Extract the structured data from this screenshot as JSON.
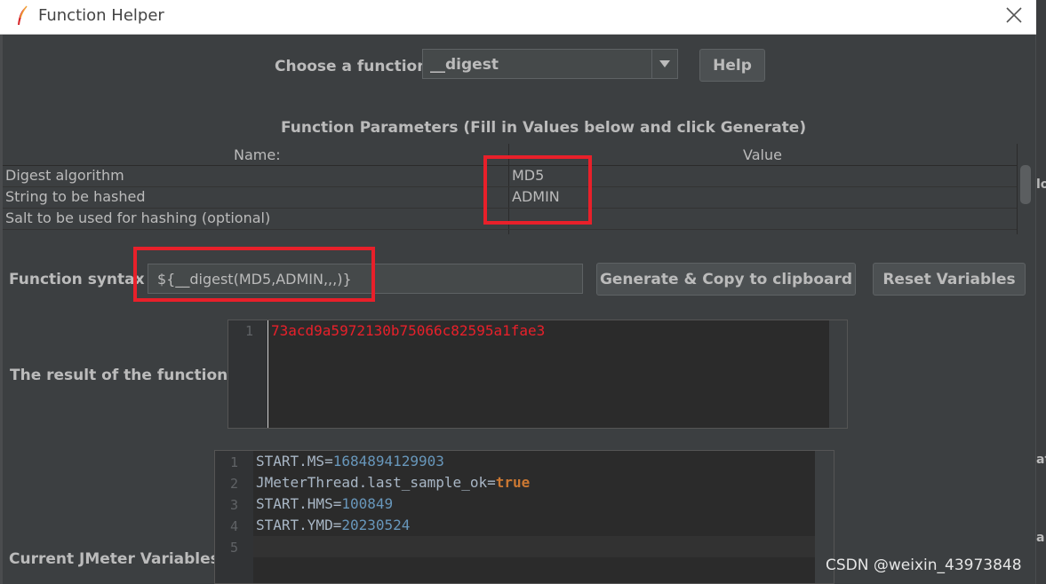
{
  "window": {
    "title": "Function Helper"
  },
  "header": {
    "choose_label": "Choose a function",
    "selected_function": "__digest",
    "help_label": "Help"
  },
  "parameters": {
    "section_title": "Function Parameters (Fill in Values below and click Generate)",
    "columns": [
      "Name:",
      "Value"
    ],
    "rows": [
      {
        "name": "Digest algorithm",
        "value": "MD5"
      },
      {
        "name": "String to be hashed",
        "value": "ADMIN"
      },
      {
        "name": "Salt to be used for hashing (optional)",
        "value": ""
      }
    ]
  },
  "syntax": {
    "label": "Function syntax",
    "value": "${__digest(MD5,ADMIN,,,)}",
    "generate_label": "Generate & Copy to clipboard",
    "reset_label": "Reset Variables"
  },
  "result": {
    "label": "The result of the function is",
    "lines": [
      {
        "no": "1",
        "text": "73acd9a5972130b75066c82595a1fae3"
      }
    ],
    "text_color": "#e8202a"
  },
  "variables": {
    "label": "Current JMeter Variables",
    "lines": [
      {
        "no": "1",
        "key": "START.MS",
        "eq": "=",
        "value": "1684894129903"
      },
      {
        "no": "2",
        "key": "JMeterThread.last_sample_ok",
        "eq": "=",
        "value": "true"
      },
      {
        "no": "3",
        "key": "START.HMS",
        "eq": "=",
        "value": "100849"
      },
      {
        "no": "4",
        "key": "START.YMD",
        "eq": "=",
        "value": "20230524"
      },
      {
        "no": "5",
        "key": "",
        "eq": "",
        "value": ""
      }
    ]
  },
  "right_strip": {
    "frag1": "lo",
    "frag2": "at",
    "frag3": "a"
  },
  "watermark": "CSDN @weixin_43973848",
  "colors": {
    "dialog_bg": "#3c3f41",
    "highlight": "#e8202a",
    "editor_bg": "#2b2b2b",
    "number": "#6897bb",
    "keyword": "#cc7832"
  },
  "icons": {
    "app": "feather-icon",
    "close": "close-icon",
    "dropdown": "chevron-down-icon"
  }
}
